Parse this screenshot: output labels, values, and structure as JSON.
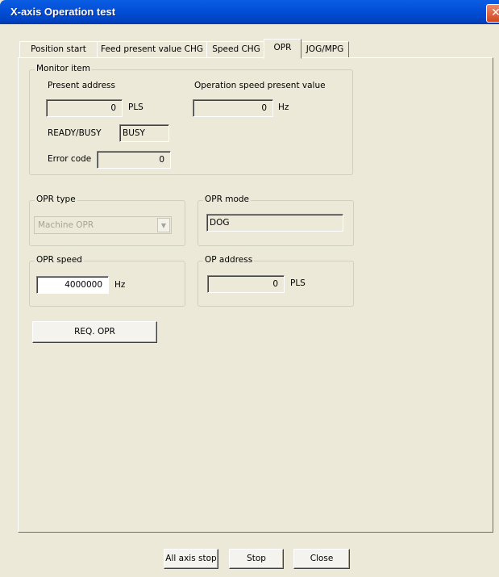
{
  "window": {
    "title": "X-axis Operation test"
  },
  "tabs": [
    {
      "label": "Position start",
      "active": false
    },
    {
      "label": "Feed present value CHG",
      "active": false
    },
    {
      "label": "Speed CHG",
      "active": false
    },
    {
      "label": "OPR",
      "active": true
    },
    {
      "label": "JOG/MPG",
      "active": false
    }
  ],
  "monitor": {
    "legend": "Monitor item",
    "present_address_label": "Present address",
    "present_address_value": "0",
    "present_address_unit": "PLS",
    "speed_label": "Operation speed present value",
    "speed_value": "0",
    "speed_unit": "Hz",
    "ready_busy_label": "READY/BUSY",
    "ready_busy_value": "BUSY",
    "error_code_label": "Error code",
    "error_code_value": "0"
  },
  "opr_type": {
    "legend": "OPR type",
    "selected": "Machine OPR",
    "enabled": false
  },
  "opr_mode": {
    "legend": "OPR mode",
    "value": "DOG"
  },
  "opr_speed": {
    "legend": "OPR speed",
    "value": "4000000",
    "unit": "Hz"
  },
  "op_address": {
    "legend": "OP address",
    "value": "0",
    "unit": "PLS"
  },
  "req_opr_label": "REQ. OPR",
  "footer": {
    "all_axis_stop_label": "All axis stop",
    "stop_label": "Stop",
    "close_label": "Close"
  }
}
